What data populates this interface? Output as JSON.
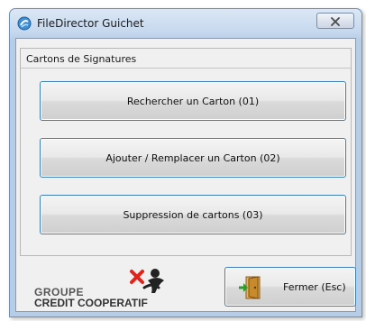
{
  "window": {
    "title": "FileDirector Guichet",
    "icon": "filedirector-app-icon",
    "close_icon": "close-icon"
  },
  "group": {
    "title": "Cartons de Signatures"
  },
  "buttons": {
    "search_label": "Rechercher un Carton (01)",
    "add_label": "Ajouter / Remplacer un Carton (02)",
    "delete_label": "Suppression de cartons (03)",
    "close_label": "Fermer (Esc)",
    "close_icon": "exit-door-icon"
  },
  "logo": {
    "line1": "GROUPE",
    "line2": "CREDIT COOPERATIF"
  },
  "colors": {
    "button_border": "#3c7fb1",
    "logo_red": "#e2231a",
    "window_frame": "#c6d8ee"
  }
}
